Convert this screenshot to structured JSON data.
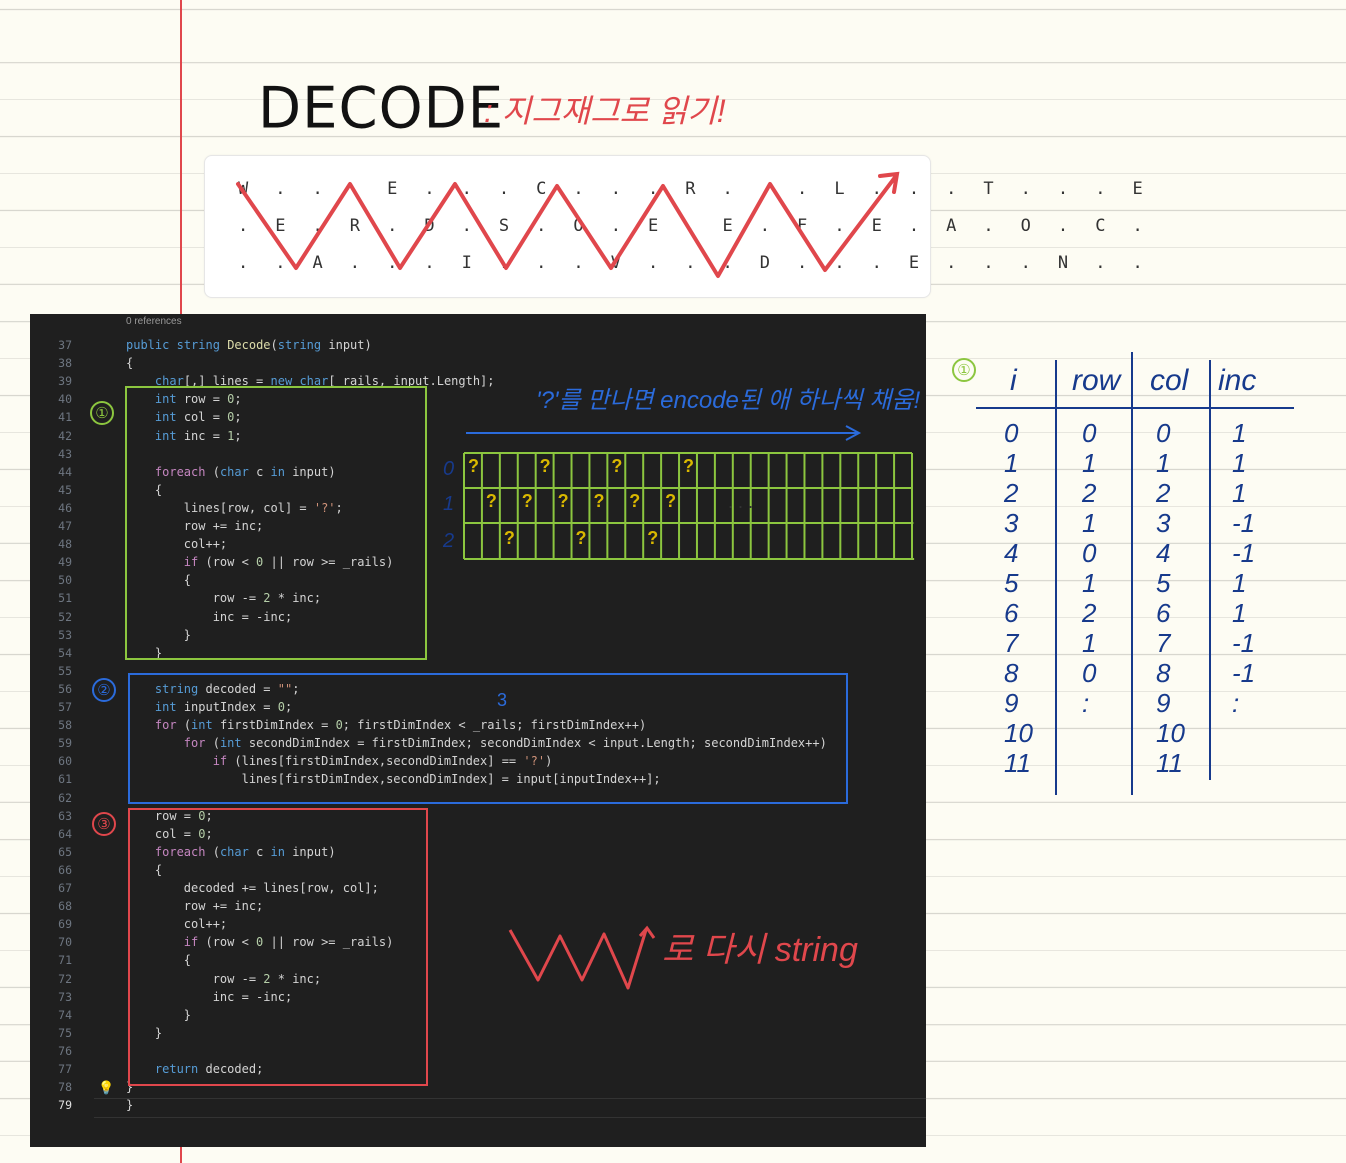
{
  "title": "DECODE",
  "subtitle": ": 지그재그로 읽기!",
  "rail_fence": {
    "rows": [
      "W . . . E . . . C . . . R . . . L . . . T . . . E",
      ". E . R . D . S . O . E . E . F . E . A . O . C .",
      ". . A . . . I . . . V . . . D . . . E . . . N . ."
    ]
  },
  "editor": {
    "references": "0 references",
    "line_numbers": [
      "37",
      "38",
      "39",
      "40",
      "41",
      "42",
      "43",
      "44",
      "45",
      "46",
      "47",
      "48",
      "49",
      "50",
      "51",
      "52",
      "53",
      "54",
      "55",
      "56",
      "57",
      "58",
      "59",
      "60",
      "61",
      "62",
      "63",
      "64",
      "65",
      "66",
      "67",
      "68",
      "69",
      "70",
      "71",
      "72",
      "73",
      "74",
      "75",
      "76",
      "77",
      "78",
      "79"
    ],
    "lines": [
      "public string Decode(string input)",
      "{",
      "    char[,] lines = new char[_rails, input.Length];",
      "    int row = 0;",
      "    int col = 0;",
      "    int inc = 1;",
      "",
      "    foreach (char c in input)",
      "    {",
      "        lines[row, col] = '?';",
      "        row += inc;",
      "        col++;",
      "        if (row < 0 || row >= _rails)",
      "        {",
      "            row -= 2 * inc;",
      "            inc = -inc;",
      "        }",
      "    }",
      "",
      "    string decoded = \"\";",
      "    int inputIndex = 0;",
      "    for (int firstDimIndex = 0; firstDimIndex < _rails; firstDimIndex++)",
      "        for (int secondDimIndex = firstDimIndex; secondDimIndex < input.Length; secondDimIndex++)",
      "            if (lines[firstDimIndex,secondDimIndex] == '?')",
      "                lines[firstDimIndex,secondDimIndex] = input[inputIndex++];",
      "",
      "    row = 0;",
      "    col = 0;",
      "    foreach (char c in input)",
      "    {",
      "        decoded += lines[row, col];",
      "        row += inc;",
      "        col++;",
      "        if (row < 0 || row >= _rails)",
      "        {",
      "            row -= 2 * inc;",
      "            inc = -inc;",
      "        }",
      "    }",
      "",
      "    return decoded;",
      "}",
      "}"
    ]
  },
  "annotations": {
    "circle_1": "①",
    "circle_2": "②",
    "circle_3": "③",
    "label_3": "3",
    "encode_note": "'?'를 만나면 encode된 애 하나씩 채움!",
    "grid_rows": [
      "0",
      "1",
      "2"
    ],
    "grid_marks": "?",
    "grid_dots": ". . .",
    "zigzag_note": "로 다시 string"
  },
  "table": {
    "marker": "①",
    "headers": [
      "i",
      "row",
      "col",
      "inc"
    ],
    "i": [
      "0",
      "1",
      "2",
      "3",
      "4",
      "5",
      "6",
      "7",
      "8",
      "9",
      "10",
      "11"
    ],
    "row": [
      "0",
      "1",
      "2",
      "1",
      "0",
      "1",
      "2",
      "1",
      "0",
      ":"
    ],
    "col": [
      "0",
      "1",
      "2",
      "3",
      "4",
      "5",
      "6",
      "7",
      "8",
      "9",
      "10",
      "11"
    ],
    "inc": [
      "1",
      "1",
      "1",
      "-1",
      "-1",
      "1",
      "1",
      "-1",
      "-1",
      ":"
    ]
  },
  "colors": {
    "red": "#e0474c",
    "green": "#8cc63f",
    "blue": "#2b6bdb",
    "yellow": "#f0d93a",
    "navy": "#173a8c"
  }
}
